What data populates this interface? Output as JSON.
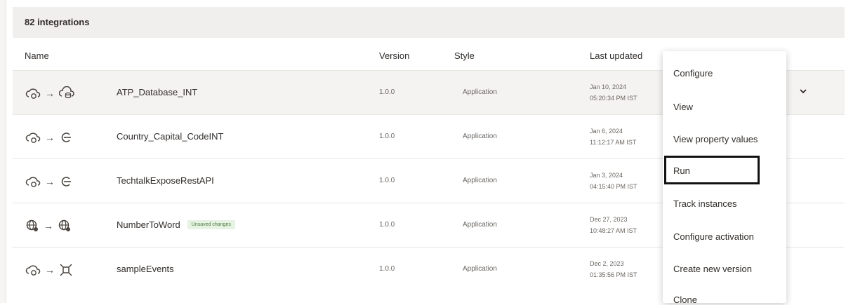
{
  "summary": {
    "count_label": "82 integrations"
  },
  "columns": {
    "name": "Name",
    "version": "Version",
    "style": "Style",
    "last_updated": "Last updated"
  },
  "rows": [
    {
      "name": "ATP_Database_INT",
      "badge": "",
      "version": "1.0.0",
      "style": "Application",
      "date": "Jan 10, 2024",
      "time": "05:20:34 PM IST",
      "source_icon": "cloud-refresh-icon",
      "target_icon": "cloud-database-icon"
    },
    {
      "name": "Country_Capital_CodeINT",
      "badge": "",
      "version": "1.0.0",
      "style": "Application",
      "date": "Jan 6, 2024",
      "time": "11:12:17 AM IST",
      "source_icon": "cloud-refresh-icon",
      "target_icon": "rest-endpoint-icon"
    },
    {
      "name": "TechtalkExposeRestAPI",
      "badge": "",
      "version": "1.0.0",
      "style": "Application",
      "date": "Jan 3, 2024",
      "time": "04:15:40 PM IST",
      "source_icon": "cloud-refresh-icon",
      "target_icon": "rest-endpoint-icon"
    },
    {
      "name": "NumberToWord",
      "badge": "Unsaved changes",
      "version": "1.0.0",
      "style": "Application",
      "date": "Dec 27, 2023",
      "time": "10:48:27 AM IST",
      "source_icon": "globe-service-icon",
      "target_icon": "globe-service-icon"
    },
    {
      "name": "sampleEvents",
      "badge": "",
      "version": "1.0.0",
      "style": "Application",
      "date": "Dec 2, 2023",
      "time": "01:35:56 PM IST",
      "source_icon": "cloud-refresh-icon",
      "target_icon": "event-hub-icon"
    }
  ],
  "menu": {
    "items": [
      "Configure",
      "View",
      "View property values",
      "Run",
      "Track instances",
      "Configure activation",
      "Create new version",
      "Clone"
    ],
    "highlighted": "Run"
  },
  "colors": {
    "header_bg": "#f1efed",
    "selected_row_bg": "#f4f3f1",
    "badge_bg": "#e6f2e2",
    "badge_text": "#4d7a3e",
    "highlight_box": "#111111"
  }
}
